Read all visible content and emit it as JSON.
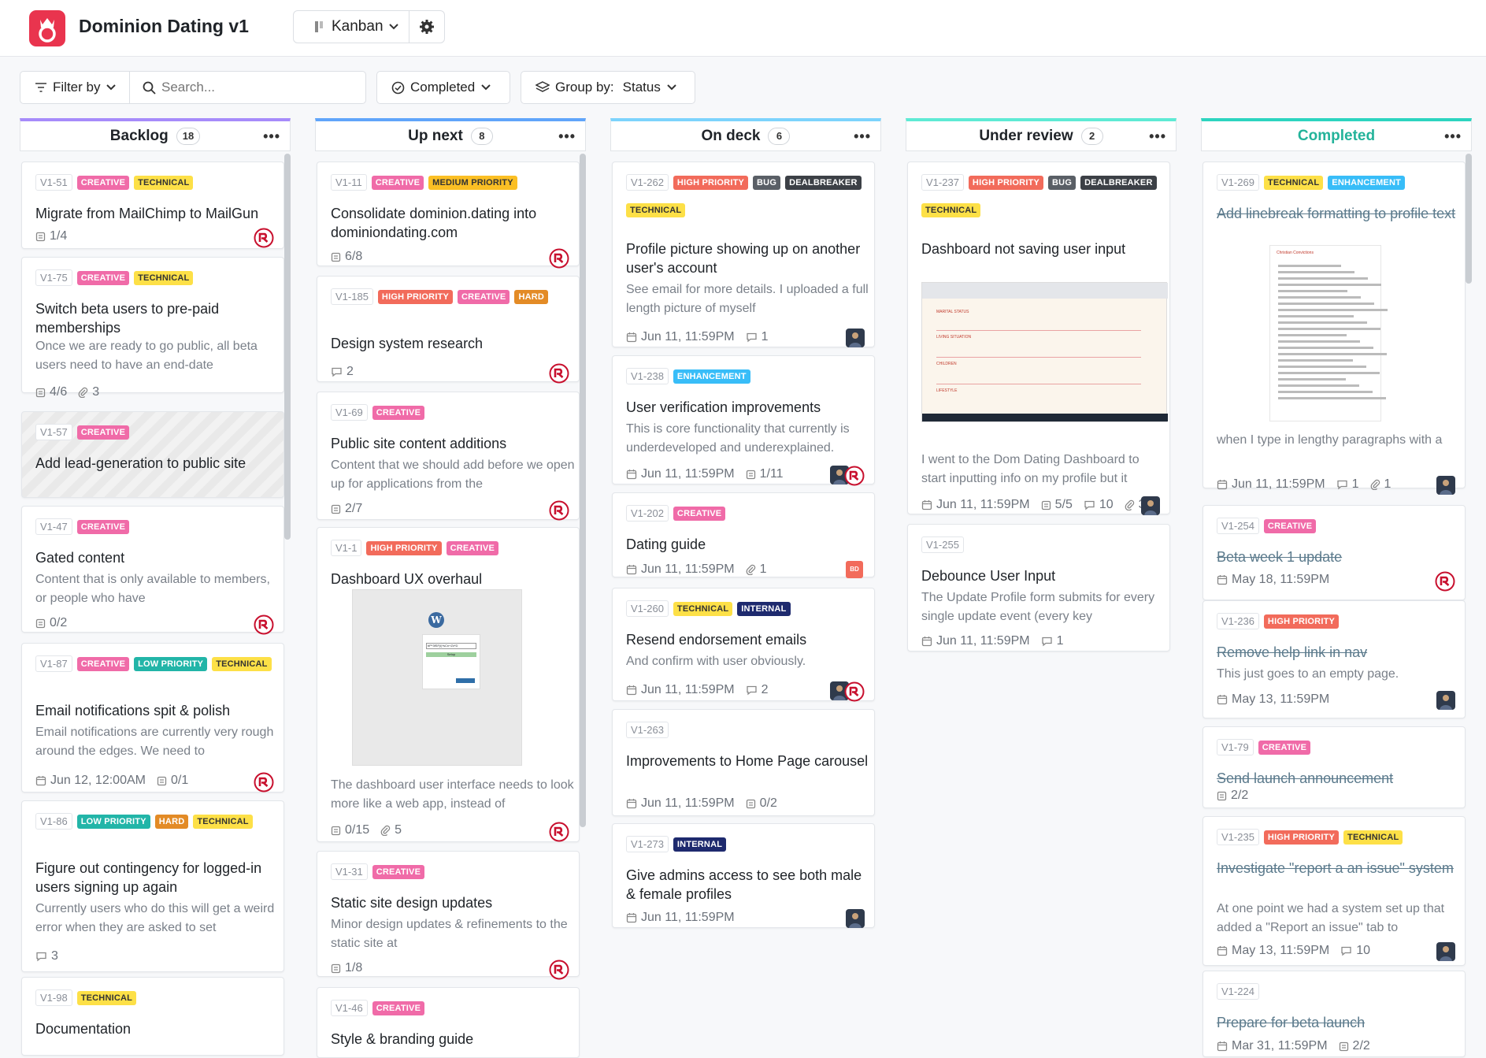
{
  "app": {
    "title": "Dominion Dating v1",
    "view": "Kanban"
  },
  "toolbar": {
    "filter": "Filter by",
    "search_placeholder": "Search...",
    "status_filter": "Completed",
    "group_label": "Group by:",
    "group_value": "Status"
  },
  "columns": [
    {
      "name": "Backlog",
      "count": "18",
      "color": "#a78bfa",
      "cards": [
        {
          "id": "V1-51",
          "tags": [
            "CREATIVE",
            "TECHNICAL"
          ],
          "title": "Migrate from MailChimp to MailGun",
          "meta": [
            "1/4"
          ]
        },
        {
          "id": "V1-75",
          "tags": [
            "CREATIVE",
            "TECHNICAL"
          ],
          "title": "Switch beta users to pre-paid memberships",
          "desc": "Once we are ready to go public, all beta users need to have an end-date",
          "meta": [
            "4/6",
            "3"
          ]
        },
        {
          "id": "V1-57",
          "tags": [
            "CREATIVE"
          ],
          "title": "Add lead-generation to public site"
        },
        {
          "id": "V1-47",
          "tags": [
            "CREATIVE"
          ],
          "title": "Gated content",
          "desc": "Content that is only available to members, or people who have",
          "meta": [
            "0/2"
          ]
        },
        {
          "id": "V1-87",
          "tags": [
            "CREATIVE",
            "LOW PRIORITY",
            "TECHNICAL"
          ],
          "title": "Email notifications spit & polish",
          "desc": "Email notifications are currently very rough around the edges. We need to",
          "meta": [
            "Jun 12, 12:00AM",
            "0/1"
          ]
        },
        {
          "id": "V1-86",
          "tags": [
            "LOW PRIORITY",
            "HARD",
            "TECHNICAL"
          ],
          "title": "Figure out contingency for logged-in users signing up again",
          "desc": "Currently users who do this will get a weird error when they are asked to set",
          "meta": [
            "3"
          ]
        },
        {
          "id": "V1-98",
          "tags": [
            "TECHNICAL"
          ],
          "title": "Documentation"
        }
      ]
    },
    {
      "name": "Up next",
      "count": "8",
      "color": "#60a5fa",
      "cards": [
        {
          "id": "V1-11",
          "tags": [
            "CREATIVE",
            "MEDIUM PRIORITY"
          ],
          "title": "Consolidate dominion.dating into dominiondating.com",
          "meta": [
            "6/8"
          ]
        },
        {
          "id": "V1-185",
          "tags": [
            "HIGH PRIORITY",
            "CREATIVE",
            "HARD"
          ],
          "title": "Design system research",
          "meta": [
            "2"
          ]
        },
        {
          "id": "V1-69",
          "tags": [
            "CREATIVE"
          ],
          "title": "Public site content additions",
          "desc": "Content that we should add before we open up for applications from the",
          "meta": [
            "2/7"
          ]
        },
        {
          "id": "V1-1",
          "tags": [
            "HIGH PRIORITY",
            "CREATIVE"
          ],
          "title": "Dashboard UX overhaul",
          "desc": "The dashboard user interface needs to look more like a web app, instead of",
          "meta": [
            "0/15",
            "5"
          ]
        },
        {
          "id": "V1-31",
          "tags": [
            "CREATIVE"
          ],
          "title": "Static site design updates",
          "desc": "Minor design updates & refinements to the static site at",
          "meta": [
            "1/8"
          ]
        },
        {
          "id": "V1-46",
          "tags": [
            "CREATIVE"
          ],
          "title": "Style & branding guide"
        }
      ]
    },
    {
      "name": "On deck",
      "count": "6",
      "color": "#7dd3fc",
      "cards": [
        {
          "id": "V1-262",
          "tags": [
            "HIGH PRIORITY",
            "BUG",
            "DEALBREAKER",
            "TECHNICAL"
          ],
          "title": "Profile picture showing up on another user's account",
          "desc": "See email for more details. I uploaded a full length picture of myself",
          "meta": [
            "Jun 11, 11:59PM",
            "1"
          ]
        },
        {
          "id": "V1-238",
          "tags": [
            "ENHANCEMENT"
          ],
          "title": "User verification improvements",
          "desc": "This is core functionality that currently is underdeveloped and underexplained.",
          "meta": [
            "Jun 11, 11:59PM",
            "1/11"
          ]
        },
        {
          "id": "V1-202",
          "tags": [
            "CREATIVE"
          ],
          "title": "Dating guide",
          "meta": [
            "Jun 11, 11:59PM",
            "1"
          ],
          "avatar": "BD"
        },
        {
          "id": "V1-260",
          "tags": [
            "TECHNICAL",
            "INTERNAL"
          ],
          "title": "Resend endorsement emails",
          "desc": "And confirm with user obviously.",
          "meta": [
            "Jun 11, 11:59PM",
            "2"
          ]
        },
        {
          "id": "V1-263",
          "tags": [],
          "title": "Improvements to Home Page carousel",
          "meta": [
            "Jun 11, 11:59PM",
            "0/2"
          ]
        },
        {
          "id": "V1-273",
          "tags": [
            "INTERNAL"
          ],
          "title": "Give admins access to see both male & female profiles",
          "meta": [
            "Jun 11, 11:59PM"
          ]
        }
      ]
    },
    {
      "name": "Under review",
      "count": "2",
      "color": "#5eead4",
      "cards": [
        {
          "id": "V1-237",
          "tags": [
            "HIGH PRIORITY",
            "BUG",
            "DEALBREAKER",
            "TECHNICAL"
          ],
          "title": "Dashboard not saving user input",
          "desc": "I went to the Dom Dating Dashboard to start inputting info on my profile but it",
          "meta": [
            "Jun 11, 11:59PM",
            "5/5",
            "10",
            "3"
          ]
        },
        {
          "id": "V1-255",
          "tags": [],
          "title": "Debounce User Input",
          "desc": "The Update Profile form submits for every single update event (every key",
          "meta": [
            "Jun 11, 11:59PM",
            "1"
          ]
        }
      ]
    },
    {
      "name": "Completed",
      "count": "",
      "color": "#2dd4bf",
      "cards": [
        {
          "id": "V1-269",
          "tags": [
            "TECHNICAL",
            "ENHANCEMENT"
          ],
          "title": "Add linebreak formatting to profile text",
          "desc": "when I type in lengthy paragraphs with a space between them, the spacing is",
          "meta": [
            "Jun 11, 11:59PM",
            "1",
            "1"
          ]
        },
        {
          "id": "V1-254",
          "tags": [
            "CREATIVE"
          ],
          "title": "Beta week 1 update",
          "meta": [
            "May 18, 11:59PM"
          ]
        },
        {
          "id": "V1-236",
          "tags": [
            "HIGH PRIORITY"
          ],
          "title": "Remove help link in nav",
          "desc": "This just goes to an empty page.",
          "meta": [
            "May 13, 11:59PM"
          ]
        },
        {
          "id": "V1-79",
          "tags": [
            "CREATIVE"
          ],
          "title": "Send launch announcement",
          "meta": [
            "2/2"
          ]
        },
        {
          "id": "V1-235",
          "tags": [
            "HIGH PRIORITY",
            "TECHNICAL"
          ],
          "title": "Investigate \"report a an issue\" system",
          "desc": "At one point we had a system set up that added a \"Report an issue\" tab to",
          "meta": [
            "May 13, 11:59PM",
            "10"
          ]
        },
        {
          "id": "V1-224",
          "tags": [],
          "title": "Prepare for beta launch",
          "meta": [
            "Mar 31, 11:59PM",
            "2/2"
          ]
        }
      ]
    }
  ],
  "thumbnails": {
    "wp_logo": "W",
    "wp_input_code": "bP*3fSF(i)*sCn+Zx*D",
    "wp_button": "Setup",
    "doc_heading": "Christian Convictions",
    "form_section_1": "MARITAL STATUS",
    "form_section_2": "LIVING SITUATION",
    "form_section_3": "CHILDREN",
    "form_section_4": "LIFESTYLE"
  },
  "colors": {
    "accent": "#e9344e",
    "creative": "#f06ba8",
    "technical": "#fde047",
    "high": "#f26b5b",
    "enhancement": "#38bdf8",
    "internal": "#1e2a6e",
    "low": "#22b5a8"
  }
}
